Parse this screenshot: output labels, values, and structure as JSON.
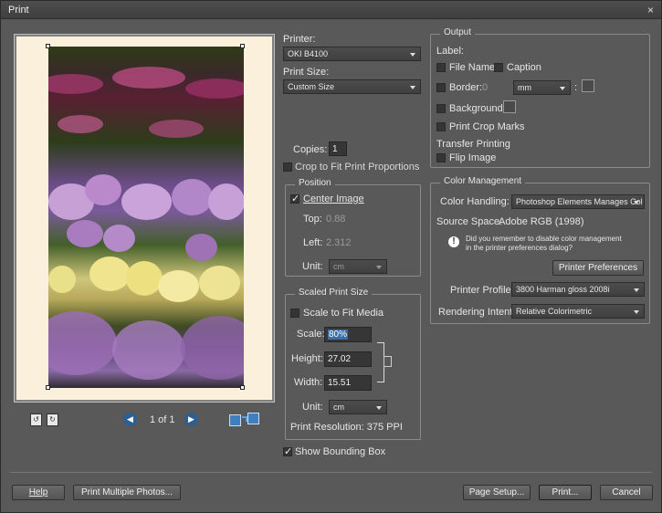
{
  "window": {
    "title": "Print",
    "close_glyph": "×"
  },
  "preview": {
    "page_indicator": "1 of 1"
  },
  "printer": {
    "label": "Printer:",
    "value": "OKI B4100"
  },
  "print_size": {
    "label": "Print Size:",
    "value": "Custom Size"
  },
  "copies": {
    "label": "Copies:",
    "value": "1"
  },
  "crop_fit": {
    "label": "Crop to Fit Print Proportions",
    "checked": false
  },
  "position": {
    "title": "Position",
    "center_image_label": "Center Image",
    "center_image_checked": true,
    "top_label": "Top:",
    "top_value": "0.88",
    "left_label": "Left:",
    "left_value": "2.312",
    "unit_label": "Unit:",
    "unit_value": "cm"
  },
  "scaled": {
    "title": "Scaled Print Size",
    "scale_to_fit_label": "Scale to Fit Media",
    "scale_label": "Scale:",
    "scale_value": "80%",
    "height_label": "Height:",
    "height_value": "27.02",
    "width_label": "Width:",
    "width_value": "15.51",
    "unit_label": "Unit:",
    "unit_value": "cm",
    "resolution": "Print Resolution: 375 PPI"
  },
  "show_bounding_box": {
    "label": "Show Bounding Box",
    "checked": true
  },
  "output": {
    "title": "Output",
    "label_heading": "Label:",
    "file_name": "File Name",
    "caption": "Caption",
    "border": "Border:",
    "border_value": "0",
    "border_unit": "mm",
    "colon": ":",
    "background": "Background:",
    "print_crop_marks": "Print Crop Marks",
    "transfer_heading": "Transfer Printing",
    "flip_image": "Flip Image"
  },
  "color": {
    "title": "Color Management",
    "handling_label": "Color Handling:",
    "handling_value": "Photoshop Elements Manages Col",
    "source_label": "Source Space:",
    "source_value": "Adobe RGB (1998)",
    "reminder_line1": "Did you remember to disable color management",
    "reminder_line2": "in the printer preferences dialog?",
    "printer_prefs_button": "Printer Preferences",
    "profile_label": "Printer Profile:",
    "profile_value": "3800 Harman gloss 2008i",
    "intent_label": "Rendering Intent:",
    "intent_value": "Relative Colorimetric"
  },
  "buttons": {
    "help": "Help",
    "print_multiple": "Print Multiple Photos...",
    "page_setup": "Page Setup...",
    "print": "Print...",
    "cancel": "Cancel"
  },
  "colors": {
    "dialog_bg": "#595959",
    "titlebar": "#454545",
    "accent_highlight": "#3a6ea5"
  }
}
